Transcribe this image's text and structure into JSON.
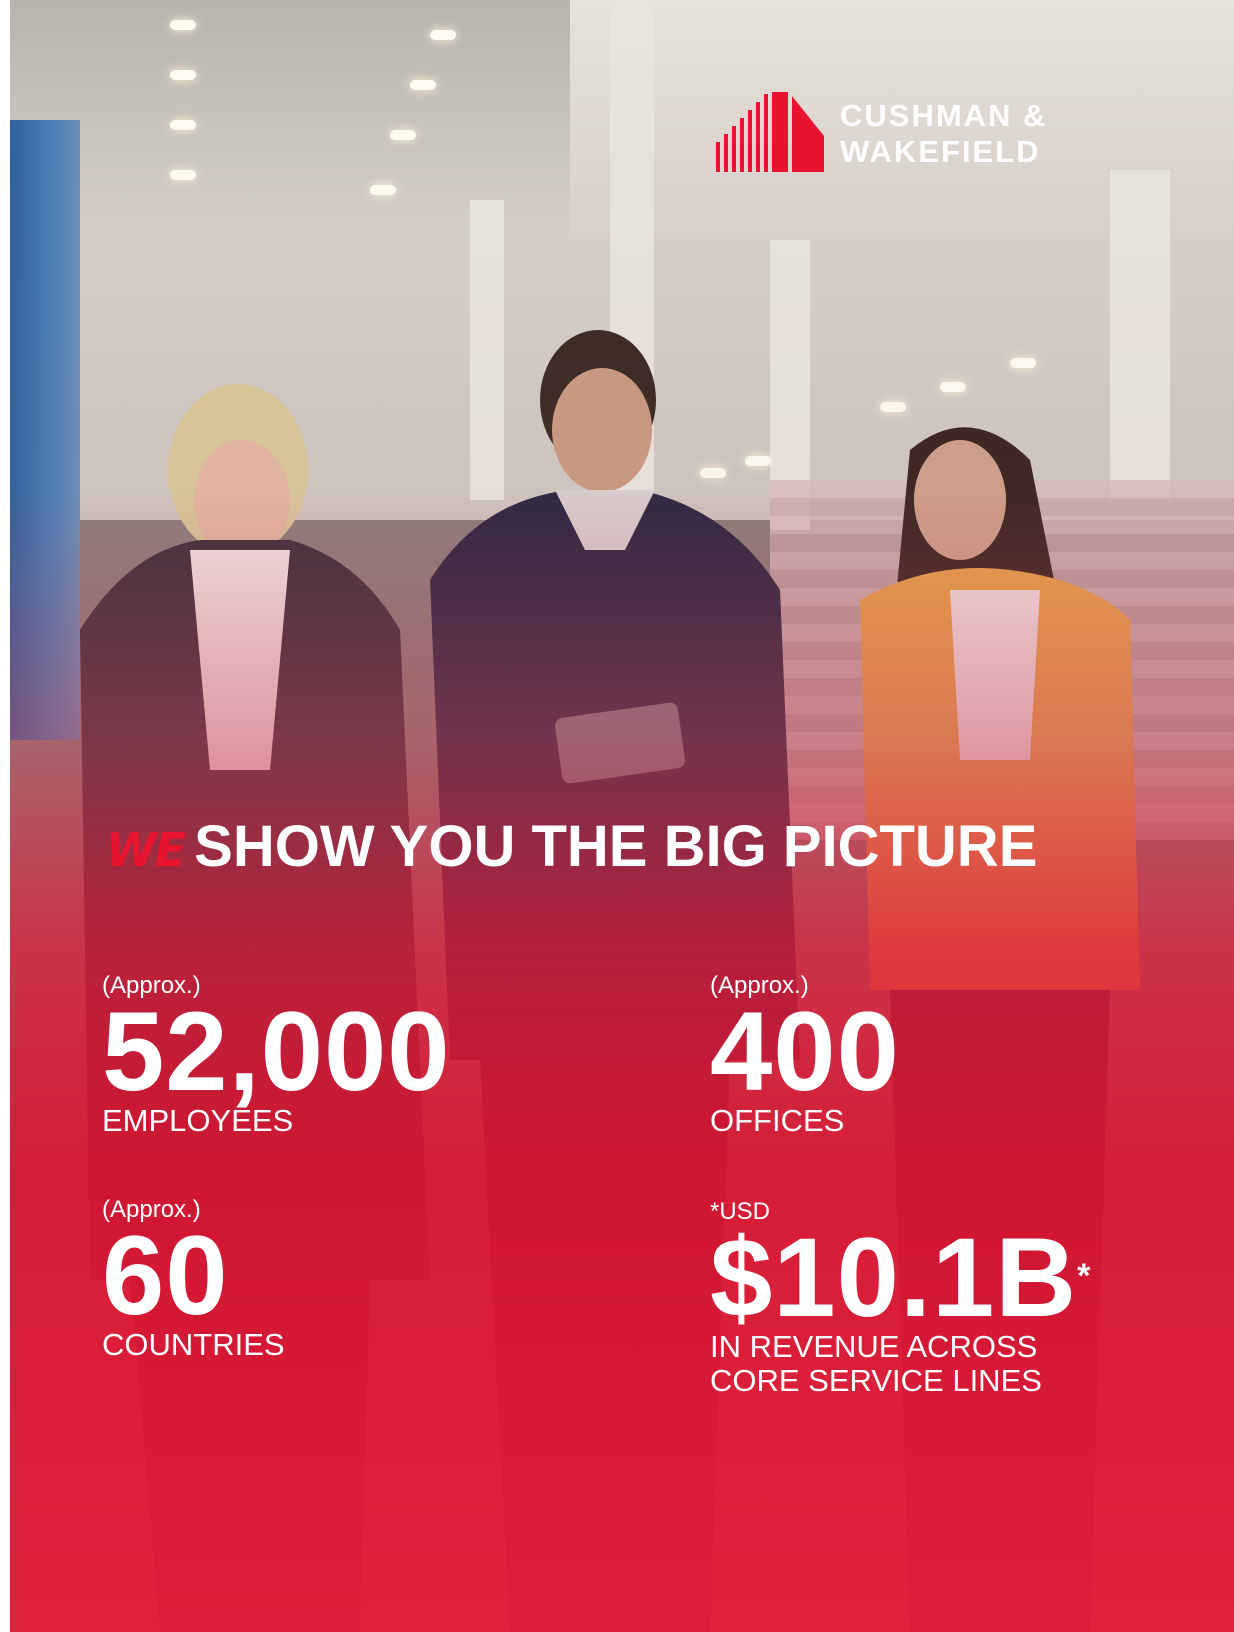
{
  "brand": {
    "name_line1": "CUSHMAN &",
    "name_line2": "WAKEFIELD",
    "color": "#e8132f"
  },
  "headline": {
    "accent": "WE",
    "text": "SHOW YOU THE BIG PICTURE"
  },
  "stats": {
    "employees": {
      "prefix": "(Approx.)",
      "value": "52,000",
      "label": "EMPLOYEES"
    },
    "offices": {
      "prefix": "(Approx.)",
      "value": "400",
      "label": "OFFICES"
    },
    "countries": {
      "prefix": "(Approx.)",
      "value": "60",
      "label": "COUNTRIES"
    },
    "revenue": {
      "prefix": "*USD",
      "value": "$10.1B",
      "marker": "*",
      "label_line1": "IN REVENUE ACROSS",
      "label_line2": "CORE SERVICE LINES"
    }
  },
  "colors": {
    "overlay_red": "#e41e3a",
    "text": "#ffffff"
  }
}
